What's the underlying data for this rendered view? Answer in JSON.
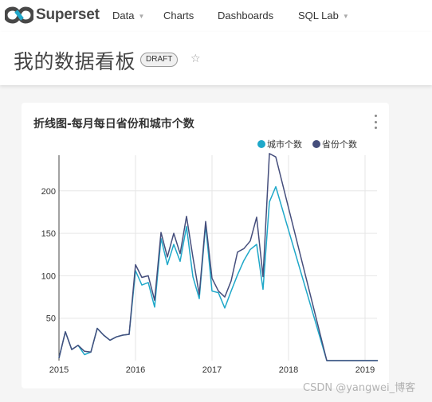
{
  "nav": {
    "brand": "Superset",
    "items": [
      {
        "label": "Data",
        "has_dropdown": true
      },
      {
        "label": "Charts",
        "has_dropdown": false
      },
      {
        "label": "Dashboards",
        "has_dropdown": false
      },
      {
        "label": "SQL Lab",
        "has_dropdown": true
      }
    ],
    "caret": "▼"
  },
  "dashboard": {
    "title": "我的数据看板",
    "status_badge": "DRAFT",
    "favorite_icon": "☆"
  },
  "chart_card": {
    "title": "折线图-每月每日省份和城市个数",
    "menu_icon": "kebab-vertical"
  },
  "watermark": "CSDN @yangwei_博客",
  "chart_data": {
    "type": "line",
    "title": "折线图-每月每日省份和城市个数",
    "xlabel": "",
    "ylabel": "",
    "x_ticks": [
      "2015",
      "2016",
      "2017",
      "2018",
      "2019"
    ],
    "y_ticks": [
      50,
      100,
      150,
      200
    ],
    "ylim": [
      0,
      245
    ],
    "xlim": [
      "2015-01",
      "2019-03"
    ],
    "grid": true,
    "legend_position": "top-right",
    "x": [
      "2015-01",
      "2015-02",
      "2015-03",
      "2015-04",
      "2015-05",
      "2015-06",
      "2015-07",
      "2015-08",
      "2015-09",
      "2015-10",
      "2015-11",
      "2015-12",
      "2016-01",
      "2016-02",
      "2016-03",
      "2016-04",
      "2016-05",
      "2016-06",
      "2016-07",
      "2016-08",
      "2016-09",
      "2016-10",
      "2016-11",
      "2016-12",
      "2017-01",
      "2017-02",
      "2017-03",
      "2017-04",
      "2017-05",
      "2017-06",
      "2017-07",
      "2017-08",
      "2017-09",
      "2017-10",
      "2017-11",
      "2018-07",
      "2018-08",
      "2018-09",
      "2018-10",
      "2018-11",
      "2018-12",
      "2019-01",
      "2019-02",
      "2019-03"
    ],
    "series": [
      {
        "name": "城市个数",
        "color": "#1fa8c9",
        "values": [
          3,
          34,
          13,
          18,
          7,
          10,
          38,
          30,
          24,
          28,
          30,
          31,
          106,
          89,
          92,
          63,
          144,
          113,
          137,
          117,
          158,
          99,
          73,
          160,
          82,
          80,
          62,
          82,
          101,
          118,
          131,
          137,
          84,
          187,
          205,
          0,
          0,
          0,
          0,
          0,
          0,
          0,
          0,
          0
        ]
      },
      {
        "name": "省份个数",
        "color": "#454e7c",
        "values": [
          3,
          34,
          13,
          18,
          11,
          10,
          38,
          30,
          24,
          28,
          30,
          31,
          113,
          98,
          100,
          71,
          151,
          122,
          150,
          126,
          170,
          122,
          78,
          164,
          97,
          82,
          75,
          94,
          128,
          132,
          141,
          169,
          99,
          244,
          240,
          0,
          0,
          0,
          0,
          0,
          0,
          0,
          0,
          0
        ]
      }
    ]
  }
}
